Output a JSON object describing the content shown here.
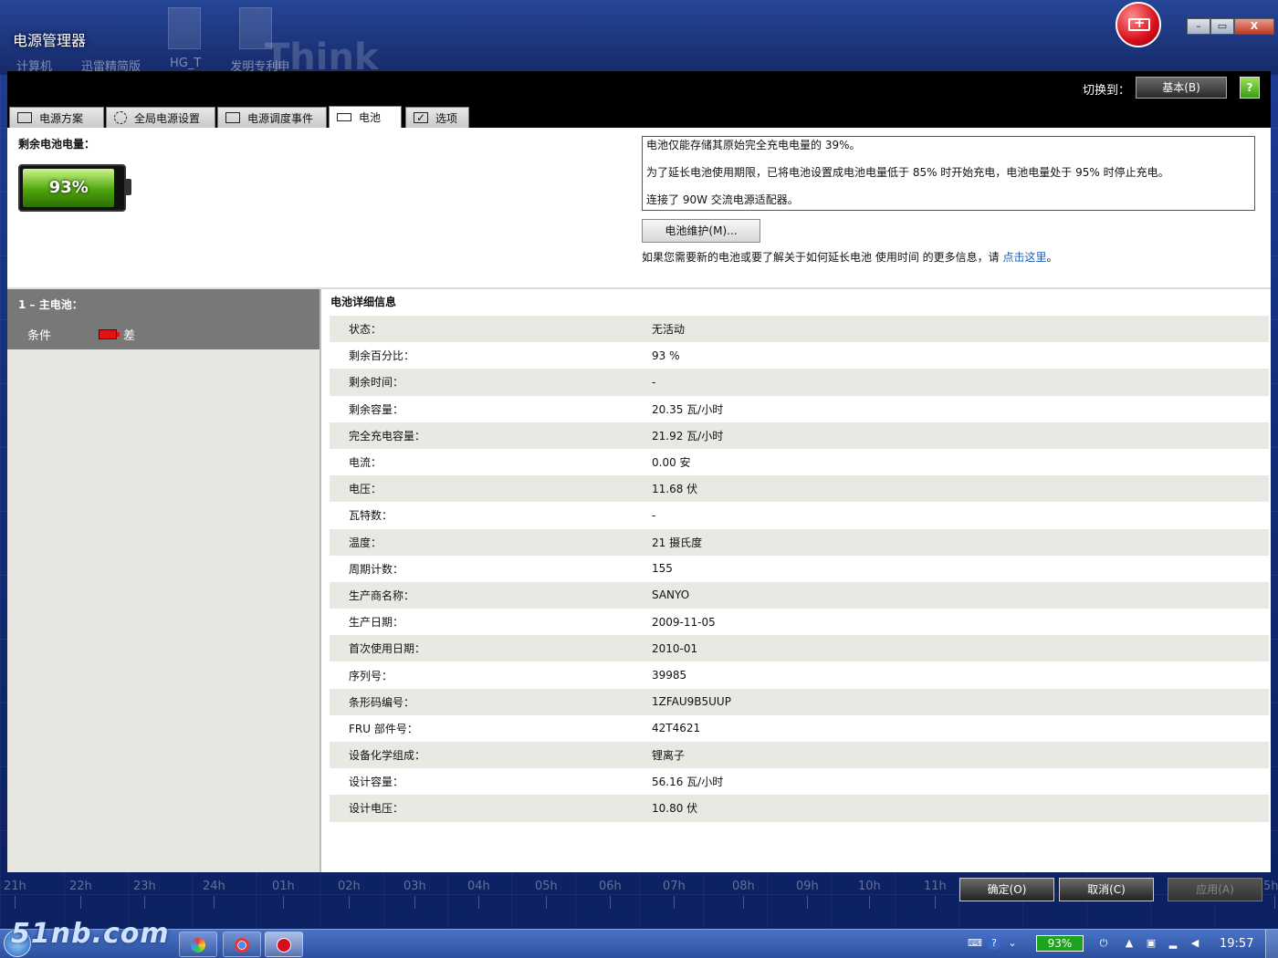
{
  "window": {
    "title": "电源管理器",
    "desktop_icons": [
      "计算机",
      "迅雷精简版",
      "HG_T",
      "发明专利申"
    ],
    "brand_watermark": "Think"
  },
  "header": {
    "switch_label": "切换到：",
    "switch_button": "基本(B)",
    "help_icon": "?"
  },
  "tabs": [
    {
      "label": "电源方案",
      "icon": "power-plan-icon",
      "active": false
    },
    {
      "label": "全局电源设置",
      "icon": "gear-icon",
      "active": false
    },
    {
      "label": "电源调度事件",
      "icon": "schedule-icon",
      "active": false
    },
    {
      "label": "电池",
      "icon": "battery-icon",
      "active": true
    },
    {
      "label": "选项",
      "icon": "checkbox-icon",
      "active": false
    }
  ],
  "battery_summary": {
    "remaining_label": "剩余电池电量：",
    "percent_text": "93%",
    "percent": 93
  },
  "info": {
    "line1": "电池仅能存储其原始完全充电电量的 39%。",
    "line2": "为了延长电池使用期限，已将电池设置成电池电量低于 85% 时开始充电，电池电量处于 95% 时停止充电。",
    "line3": "连接了 90W 交流电源适配器。",
    "maintenance_button": "电池维护(M)...",
    "more_text": "如果您需要新的电池或要了解关于如何延长电池 使用时间 的更多信息，请 ",
    "more_link": "点击这里",
    "more_end": "。"
  },
  "left_panel": {
    "battery_title": "1 – 主电池：",
    "condition_label": "条件",
    "condition_value": "差",
    "condition_color": "#e01414"
  },
  "details": {
    "title": "电池详细信息",
    "rows": [
      {
        "label": "状态：",
        "value": "无活动"
      },
      {
        "label": "剩余百分比：",
        "value": "93 %"
      },
      {
        "label": "剩余时间：",
        "value": "-"
      },
      {
        "label": "剩余容量：",
        "value": "20.35 瓦/小时"
      },
      {
        "label": "完全充电容量：",
        "value": "21.92 瓦/小时"
      },
      {
        "label": "电流：",
        "value": "0.00 安"
      },
      {
        "label": "电压：",
        "value": "11.68 伏"
      },
      {
        "label": "瓦特数：",
        "value": "-"
      },
      {
        "label": "温度：",
        "value": "21 摄氏度"
      },
      {
        "label": "周期计数：",
        "value": "155"
      },
      {
        "label": "生产商名称：",
        "value": "SANYO"
      },
      {
        "label": "生产日期：",
        "value": "2009-11-05"
      },
      {
        "label": "首次使用日期：",
        "value": "2010-01"
      },
      {
        "label": "序列号：",
        "value": "39985"
      },
      {
        "label": "条形码编号：",
        "value": "1ZFAU9B5UUP"
      },
      {
        "label": "FRU 部件号：",
        "value": "42T4621"
      },
      {
        "label": "设备化学组成：",
        "value": "锂离子"
      },
      {
        "label": "设计容量：",
        "value": "56.16 瓦/小时"
      },
      {
        "label": "设计电压：",
        "value": "10.80 伏"
      }
    ]
  },
  "timeline": {
    "hours": [
      "21h",
      "22h",
      "23h",
      "24h",
      "01h",
      "02h",
      "03h",
      "04h",
      "05h",
      "06h",
      "07h",
      "08h",
      "09h",
      "10h",
      "11h",
      "5h"
    ]
  },
  "buttons": {
    "ok": "确定(O)",
    "cancel": "取消(C)",
    "apply": "应用(A)"
  },
  "taskbar": {
    "watermark": "51nb.com",
    "battery_percent": "93%",
    "time": "19:57"
  }
}
